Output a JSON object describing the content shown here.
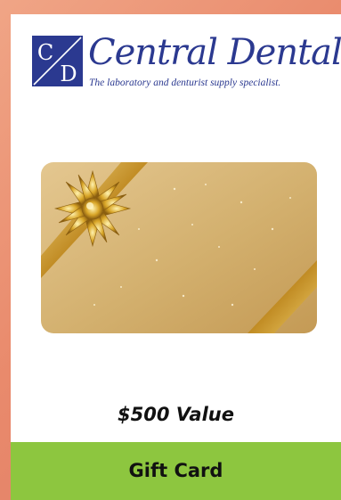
{
  "brand": {
    "logo_letters": [
      "C",
      "D"
    ],
    "name": "Central Dental",
    "tagline": "The laboratory and denturist supply specialist.",
    "color": "#2b3990"
  },
  "product": {
    "value": "$500 Value",
    "label": "Gift Card",
    "image_icon": "gold-bow-gift-card"
  },
  "colors": {
    "background": "#e98a6c",
    "band": "#8dc63f",
    "gold": "#d4b06e"
  }
}
